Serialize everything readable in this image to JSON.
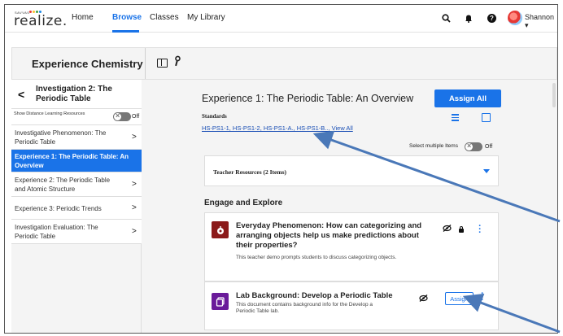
{
  "brand": {
    "small": "SAVVAS",
    "word": "realize.",
    "dot_colors": [
      "#e53935",
      "#fbc02d",
      "#43a047",
      "#1e88e5"
    ]
  },
  "nav": {
    "home": "Home",
    "browse": "Browse",
    "classes": "Classes",
    "library": "My Library",
    "user": "Shannon",
    "accent": "#1a73e8"
  },
  "course": {
    "title": "Experience Chemistry"
  },
  "sidebar": {
    "back_title": "Investigation 2: The Periodic Table",
    "distance_label": "Show Distance Learning Resources",
    "distance_state": "Off",
    "items": [
      {
        "label": "Investigative Phenomenon: The Periodic Table",
        "active": false
      },
      {
        "label": "Experience 1: The Periodic Table: An Overview",
        "active": true
      },
      {
        "label": "Experience 2: The Periodic Table and Atomic Structure",
        "active": false
      },
      {
        "label": "Experience 3: Periodic Trends",
        "active": false
      },
      {
        "label": "Investigation Evaluation: The Periodic Table",
        "active": false
      }
    ]
  },
  "main": {
    "title": "Experience 1: The Periodic Table: An Overview",
    "assign_all": "Assign All",
    "standards_label": "Standards",
    "standards_links": "HS-PS1-1, HS-PS1-2, HS-PS1-A., HS-PS1-B.., View All",
    "select_multiple": "Select multiple Items",
    "select_state": "Off",
    "teacher_resources": "Teacher Resources (2 Items)",
    "section": "Engage and Explore",
    "cards": [
      {
        "title": "Everyday Phenomenon: How can categorizing and arranging objects help us make predictions about their properties?",
        "desc": "This teacher demo prompts students to discuss categorizing objects.",
        "icon_color": "#8b1a1a"
      },
      {
        "title": "Lab Background: Develop a Periodic Table",
        "desc": "This document contains background info for the Develop a Periodic Table lab.",
        "assign": "Assign",
        "icon_color": "#6a1b9a"
      }
    ]
  }
}
